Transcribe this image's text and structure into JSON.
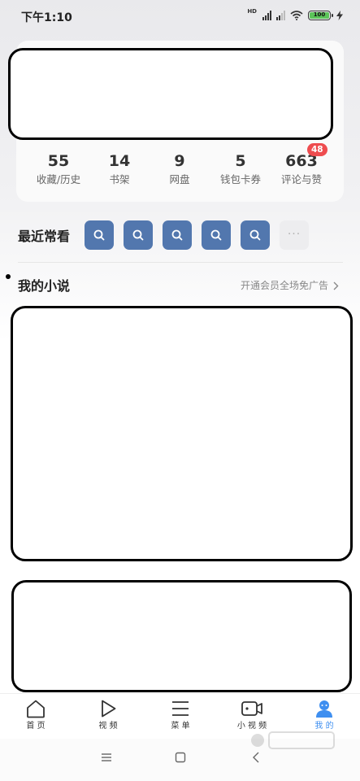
{
  "status_bar": {
    "time": "下午1:10",
    "battery": "100"
  },
  "stats": [
    {
      "value": "55",
      "label": "收藏/历史"
    },
    {
      "value": "14",
      "label": "书架"
    },
    {
      "value": "9",
      "label": "网盘"
    },
    {
      "value": "5",
      "label": "钱包卡券"
    },
    {
      "value": "663",
      "label": "评论与赞",
      "badge": "48"
    }
  ],
  "recent": {
    "label": "最近常看",
    "items": [
      {
        "icon": "search-icon"
      },
      {
        "icon": "search-icon"
      },
      {
        "icon": "search-icon"
      },
      {
        "icon": "search-icon"
      },
      {
        "icon": "search-icon"
      }
    ],
    "more": "···"
  },
  "novel_section": {
    "title": "我的小说",
    "link": "开通会员全场免广告"
  },
  "bottom_nav": [
    {
      "label": "首 页",
      "icon": "home-icon"
    },
    {
      "label": "视 频",
      "icon": "play-icon"
    },
    {
      "label": "菜 单",
      "icon": "menu-icon"
    },
    {
      "label": "小 视 频",
      "icon": "short-video-icon"
    },
    {
      "label": "我 的",
      "icon": "profile-icon",
      "active": true
    }
  ],
  "colors": {
    "accent": "#3f8ff0",
    "recent_tile": "#5277ae",
    "badge": "#ee4c4f",
    "battery": "#5cc45a"
  }
}
